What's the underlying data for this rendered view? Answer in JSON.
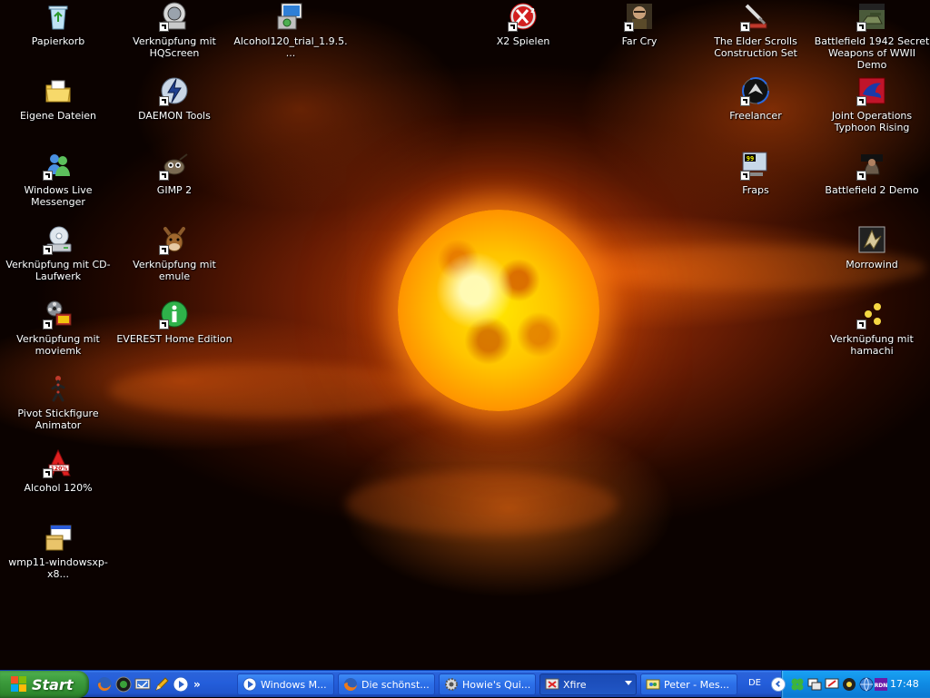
{
  "desktop": {
    "icons": [
      {
        "label": "Papierkorb",
        "icon": "recycle-bin-icon"
      },
      {
        "label": "Verknüpfung mit HQScreen",
        "icon": "hqscreen-icon"
      },
      {
        "label": "Alcohol120_trial_1.9.5....",
        "icon": "installer-icon"
      },
      {
        "label": "X2 Spielen",
        "icon": "x2-game-icon"
      },
      {
        "label": "Far Cry",
        "icon": "far-cry-icon"
      },
      {
        "label": "The Elder Scrolls Construction Set",
        "icon": "construction-set-icon"
      },
      {
        "label": "Battlefield 1942 Secret Weapons of WWII Demo",
        "icon": "battlefield-1942-icon"
      },
      {
        "label": "Eigene Dateien",
        "icon": "my-documents-icon"
      },
      {
        "label": "DAEMON Tools",
        "icon": "daemon-tools-icon"
      },
      {
        "label": "Freelancer",
        "icon": "freelancer-icon"
      },
      {
        "label": "Joint Operations Typhoon Rising",
        "icon": "joint-operations-icon"
      },
      {
        "label": "Windows Live Messenger",
        "icon": "messenger-icon"
      },
      {
        "label": "GIMP 2",
        "icon": "gimp-icon"
      },
      {
        "label": "Fraps",
        "icon": "fraps-icon"
      },
      {
        "label": "Battlefield 2 Demo",
        "icon": "battlefield-2-icon"
      },
      {
        "label": "Verknüpfung mit CD-Laufwerk",
        "icon": "cd-drive-icon"
      },
      {
        "label": "Verknüpfung mit emule",
        "icon": "emule-icon"
      },
      {
        "label": "Morrowind",
        "icon": "morrowind-icon"
      },
      {
        "label": "Verknüpfung mit moviemk",
        "icon": "movie-maker-icon"
      },
      {
        "label": "EVEREST Home Edition",
        "icon": "everest-icon"
      },
      {
        "label": "Verknüpfung mit hamachi",
        "icon": "hamachi-icon"
      },
      {
        "label": "Pivot Stickfigure Animator",
        "icon": "pivot-icon"
      },
      {
        "label": "Alcohol 120%",
        "icon": "alcohol-icon"
      },
      {
        "label": "wmp11-windowsxp-x8...",
        "icon": "wmp-installer-icon"
      }
    ]
  },
  "taskbar": {
    "start_label": "Start",
    "quick_launch": [
      "firefox-icon",
      "media-icon",
      "show-desktop-icon",
      "pencil-icon",
      "media-player-icon"
    ],
    "quick_more": "»",
    "tasks": [
      {
        "label": "Windows M...",
        "icon": "media-player-icon"
      },
      {
        "label": "Die schönst...",
        "icon": "firefox-icon"
      },
      {
        "label": "Howie's Qui...",
        "icon": "gear-icon"
      },
      {
        "label": "Xfire",
        "icon": "xfire-icon"
      },
      {
        "label": "Peter - Mes...",
        "icon": "chat-icon"
      }
    ],
    "language": "DE",
    "tray_icons": [
      "clover-icon",
      "network-icon",
      "monitor-icon",
      "hamachi-tray-icon",
      "globe-icon",
      "volume-icon",
      "rdn-icon"
    ],
    "clock": "17:48"
  },
  "colors": {
    "taskbar_blue": "#245edb",
    "start_green": "#3c9b3c",
    "tray_blue": "#0f8ae3",
    "sun_core": "#ffe600",
    "sky_deep": "#6a1d04"
  }
}
